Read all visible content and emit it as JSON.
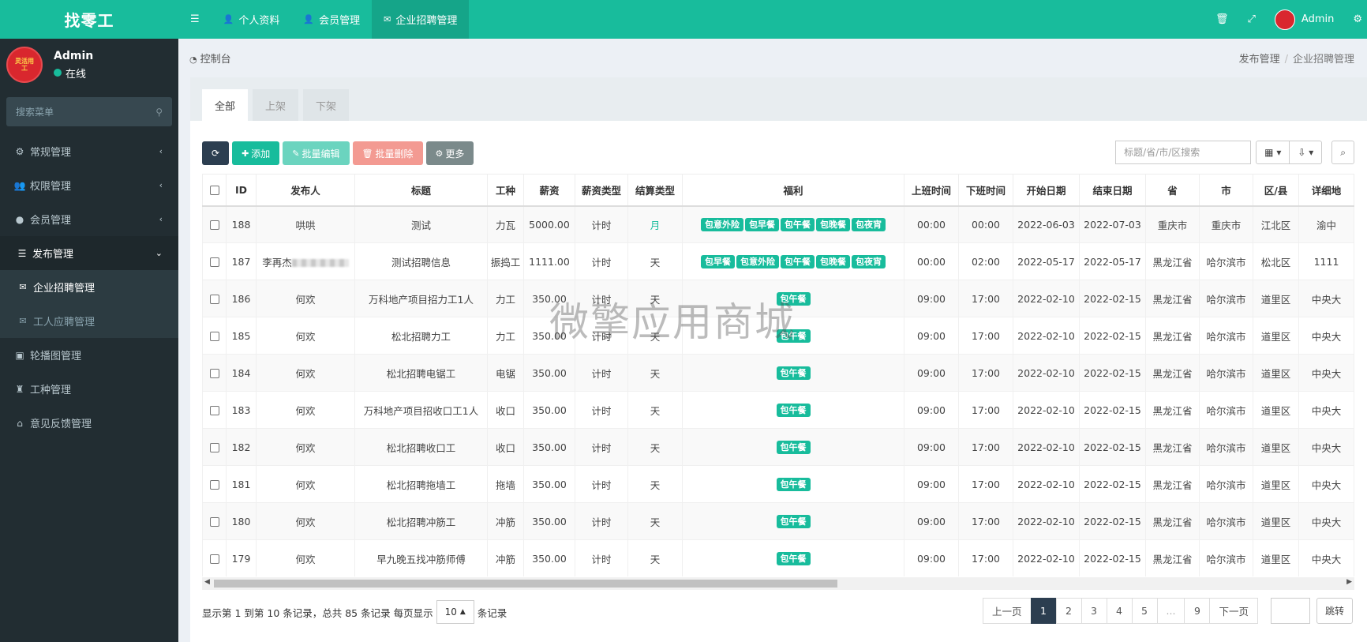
{
  "app": {
    "logo": "找零工"
  },
  "user": {
    "name": "Admin",
    "status": "在线",
    "avatar_text": "灵活用工"
  },
  "side_search": {
    "placeholder": "搜索菜单"
  },
  "menu": {
    "regular": "常规管理",
    "permissions": "权限管理",
    "members": "会员管理",
    "publish": "发布管理",
    "company_recruit": "企业招聘管理",
    "worker_apply": "工人应聘管理",
    "carousel": "轮播图管理",
    "job_type": "工种管理",
    "feedback": "意见反馈管理"
  },
  "topnav": {
    "profile": "个人资料",
    "members": "会员管理",
    "recruit": "企业招聘管理",
    "admin": "Admin"
  },
  "header": {
    "title": "控制台",
    "bc1": "发布管理",
    "bc2": "企业招聘管理"
  },
  "tabs": [
    "全部",
    "上架",
    "下架"
  ],
  "toolbar": {
    "add": "添加",
    "batch_edit": "批量编辑",
    "batch_delete": "批量删除",
    "more": "更多",
    "search_placeholder": "标题/省/市/区搜索"
  },
  "columns": [
    "ID",
    "发布人",
    "标题",
    "工种",
    "薪资",
    "薪资类型",
    "结算类型",
    "福利",
    "上班时间",
    "下班时间",
    "开始日期",
    "结束日期",
    "省",
    "市",
    "区/县",
    "详细地"
  ],
  "rows": [
    {
      "id": "188",
      "publisher": "哄哄",
      "title": "测试",
      "job": "力瓦",
      "salary": "5000.00",
      "salary_type": "计时",
      "settle": "月",
      "benefits": [
        "包意外险",
        "包早餐",
        "包午餐",
        "包晚餐",
        "包夜宵"
      ],
      "on": "00:00",
      "off": "00:00",
      "start": "2022-06-03",
      "end": "2022-07-03",
      "prov": "重庆市",
      "city": "重庆市",
      "dist": "江北区",
      "addr": "渝中"
    },
    {
      "id": "187",
      "publisher": "李再杰",
      "title": "测试招聘信息",
      "job": "振捣工",
      "salary": "1111.00",
      "salary_type": "计时",
      "settle": "天",
      "benefits": [
        "包早餐",
        "包意外险",
        "包午餐",
        "包晚餐",
        "包夜宵"
      ],
      "on": "00:00",
      "off": "02:00",
      "start": "2022-05-17",
      "end": "2022-05-17",
      "prov": "黑龙江省",
      "city": "哈尔滨市",
      "dist": "松北区",
      "addr": "1111"
    },
    {
      "id": "186",
      "publisher": "何欢",
      "title": "万科地产项目招力工1人",
      "job": "力工",
      "salary": "350.00",
      "salary_type": "计时",
      "settle": "天",
      "benefits": [
        "包午餐"
      ],
      "on": "09:00",
      "off": "17:00",
      "start": "2022-02-10",
      "end": "2022-02-15",
      "prov": "黑龙江省",
      "city": "哈尔滨市",
      "dist": "道里区",
      "addr": "中央大"
    },
    {
      "id": "185",
      "publisher": "何欢",
      "title": "松北招聘力工",
      "job": "力工",
      "salary": "350.00",
      "salary_type": "计时",
      "settle": "天",
      "benefits": [
        "包午餐"
      ],
      "on": "09:00",
      "off": "17:00",
      "start": "2022-02-10",
      "end": "2022-02-15",
      "prov": "黑龙江省",
      "city": "哈尔滨市",
      "dist": "道里区",
      "addr": "中央大"
    },
    {
      "id": "184",
      "publisher": "何欢",
      "title": "松北招聘电锯工",
      "job": "电锯",
      "salary": "350.00",
      "salary_type": "计时",
      "settle": "天",
      "benefits": [
        "包午餐"
      ],
      "on": "09:00",
      "off": "17:00",
      "start": "2022-02-10",
      "end": "2022-02-15",
      "prov": "黑龙江省",
      "city": "哈尔滨市",
      "dist": "道里区",
      "addr": "中央大"
    },
    {
      "id": "183",
      "publisher": "何欢",
      "title": "万科地产项目招收口工1人",
      "job": "收口",
      "salary": "350.00",
      "salary_type": "计时",
      "settle": "天",
      "benefits": [
        "包午餐"
      ],
      "on": "09:00",
      "off": "17:00",
      "start": "2022-02-10",
      "end": "2022-02-15",
      "prov": "黑龙江省",
      "city": "哈尔滨市",
      "dist": "道里区",
      "addr": "中央大"
    },
    {
      "id": "182",
      "publisher": "何欢",
      "title": "松北招聘收口工",
      "job": "收口",
      "salary": "350.00",
      "salary_type": "计时",
      "settle": "天",
      "benefits": [
        "包午餐"
      ],
      "on": "09:00",
      "off": "17:00",
      "start": "2022-02-10",
      "end": "2022-02-15",
      "prov": "黑龙江省",
      "city": "哈尔滨市",
      "dist": "道里区",
      "addr": "中央大"
    },
    {
      "id": "181",
      "publisher": "何欢",
      "title": "松北招聘拖墙工",
      "job": "拖墙",
      "salary": "350.00",
      "salary_type": "计时",
      "settle": "天",
      "benefits": [
        "包午餐"
      ],
      "on": "09:00",
      "off": "17:00",
      "start": "2022-02-10",
      "end": "2022-02-15",
      "prov": "黑龙江省",
      "city": "哈尔滨市",
      "dist": "道里区",
      "addr": "中央大"
    },
    {
      "id": "180",
      "publisher": "何欢",
      "title": "松北招聘冲筋工",
      "job": "冲筋",
      "salary": "350.00",
      "salary_type": "计时",
      "settle": "天",
      "benefits": [
        "包午餐"
      ],
      "on": "09:00",
      "off": "17:00",
      "start": "2022-02-10",
      "end": "2022-02-15",
      "prov": "黑龙江省",
      "city": "哈尔滨市",
      "dist": "道里区",
      "addr": "中央大"
    },
    {
      "id": "179",
      "publisher": "何欢",
      "title": "早九晚五找冲筋师傅",
      "job": "冲筋",
      "salary": "350.00",
      "salary_type": "计时",
      "settle": "天",
      "benefits": [
        "包午餐"
      ],
      "on": "09:00",
      "off": "17:00",
      "start": "2022-02-10",
      "end": "2022-02-15",
      "prov": "黑龙江省",
      "city": "哈尔滨市",
      "dist": "道里区",
      "addr": "中央大"
    }
  ],
  "watermark": "微擎应用商城",
  "pager": {
    "info_prefix": "显示第 1 到第 10 条记录，总共 85 条记录 每页显示",
    "page_size": "10",
    "info_suffix": "条记录",
    "prev": "上一页",
    "pages": [
      "1",
      "2",
      "3",
      "4",
      "5",
      "...",
      "9"
    ],
    "next": "下一页",
    "jump": "跳转"
  }
}
